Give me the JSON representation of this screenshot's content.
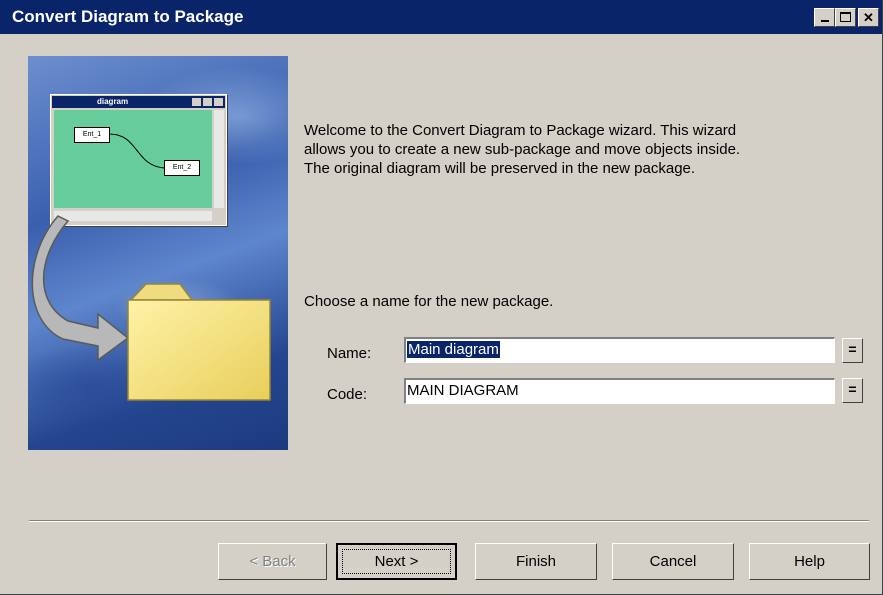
{
  "window": {
    "title": "Convert Diagram to Package",
    "controls": [
      "minimize",
      "maximize",
      "close"
    ]
  },
  "illustration": {
    "mini_window_title": "diagram",
    "entities": [
      "Ent_1",
      "Ent_2"
    ]
  },
  "intro_text": "Welcome to the Convert Diagram to Package wizard. This wizard allows you to create a new sub-package and move objects inside. The original diagram will be preserved in the new package.",
  "prompt_text": "Choose a name for the new package.",
  "form": {
    "name_label": "Name:",
    "name_value": "Main diagram",
    "code_label": "Code:",
    "code_value": "MAIN DIAGRAM",
    "equals_label": "="
  },
  "buttons": {
    "back": "< Back",
    "next": "Next >",
    "finish": "Finish",
    "cancel": "Cancel",
    "help": "Help"
  }
}
